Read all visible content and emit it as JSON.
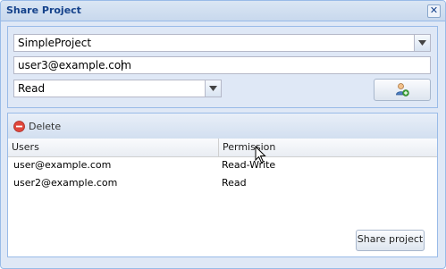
{
  "window": {
    "title": "Share Project",
    "close_glyph": "✕"
  },
  "form": {
    "project_select_value": "SimpleProject",
    "email_value": "user3@example.com",
    "permission_select_value": "Read",
    "add_user_icon": "add-user-icon"
  },
  "grid": {
    "toolbar": {
      "delete_label": "Delete",
      "delete_icon": "minus-circle-icon"
    },
    "columns": [
      "Users",
      "Permission"
    ],
    "rows": [
      {
        "user": "user@example.com",
        "permission": "Read-Write"
      },
      {
        "user": "user2@example.com",
        "permission": "Read"
      }
    ]
  },
  "actions": {
    "share_label": "Share project"
  },
  "colors": {
    "title_text": "#15428b",
    "panel_bg": "#dfe8f6",
    "border": "#99bbe8"
  }
}
